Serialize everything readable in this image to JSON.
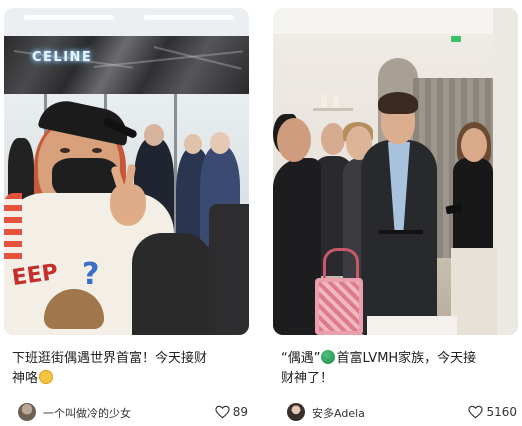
{
  "cards": [
    {
      "image": {
        "brand_text": "CELINE"
      },
      "title_line1": "下班逛街偶遇世界首富！今天接财",
      "title_line2": "神咯",
      "author": "一个叫做冷的少女",
      "likes": "89",
      "icons": {
        "title_emoji": "smiling-face-emoji",
        "like": "heart-outline-icon"
      }
    },
    {
      "image": {},
      "title_line1_a": "“偶遇”",
      "title_line1_b": "首富LVMH家族，今天接",
      "title_line2": "财神了！",
      "author": "安多Adela",
      "likes": "5160",
      "icons": {
        "title_emoji": "green-circle-emoji",
        "like": "heart-outline-icon"
      }
    }
  ],
  "colors": {
    "text": "#222222",
    "meta_text": "#333333",
    "background": "#ffffff",
    "green_emoji": "#1f8a4c",
    "yellow_emoji": "#f5c542"
  }
}
